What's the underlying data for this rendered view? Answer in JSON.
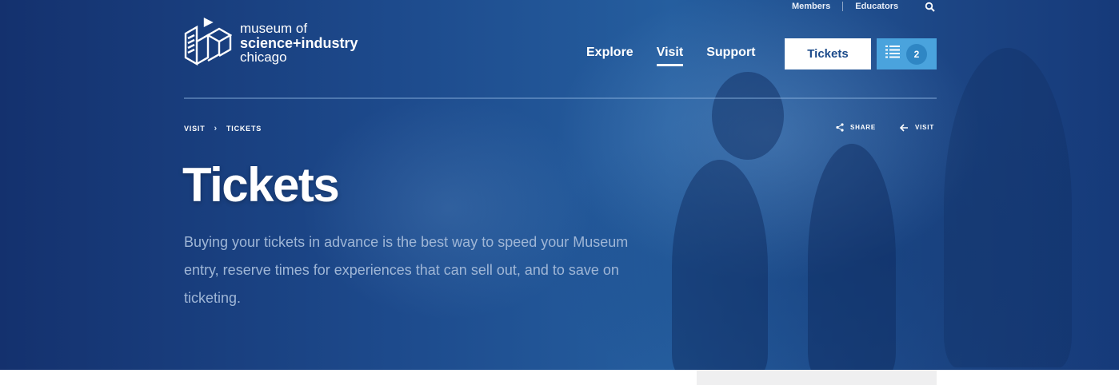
{
  "utility_nav": {
    "members": "Members",
    "educators": "Educators"
  },
  "logo": {
    "line1": "museum of",
    "line2": "science+industry",
    "line3": "chicago"
  },
  "main_nav": [
    {
      "label": "Explore",
      "active": false
    },
    {
      "label": "Visit",
      "active": true
    },
    {
      "label": "Support",
      "active": false
    }
  ],
  "tickets_button": "Tickets",
  "itinerary_count": "2",
  "breadcrumb": {
    "parent": "VISIT",
    "separator": "›",
    "current": "TICKETS"
  },
  "actions": {
    "share": "SHARE",
    "back": "VISIT"
  },
  "page": {
    "title": "Tickets",
    "lede": "Buying your tickets in advance is the best way to speed your Museum entry, reserve times for experiences that can sell out, and to save on ticketing."
  },
  "colors": {
    "hero_blue": "#1d4a8c",
    "accent_blue": "#4aa3dd",
    "button_text": "#1b4a8a"
  },
  "icons": [
    "search-icon",
    "list-icon",
    "share-icon",
    "arrow-left-icon"
  ]
}
